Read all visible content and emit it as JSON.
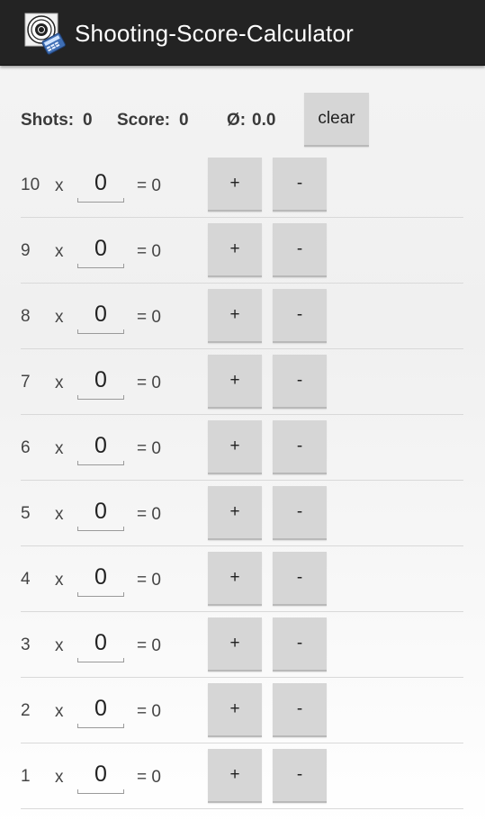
{
  "app": {
    "title": "Shooting-Score-Calculator",
    "icon": "target-calculator-icon"
  },
  "summary": {
    "shots_label": "Shots:",
    "shots_value": "0",
    "score_label": "Score:",
    "score_value": "0",
    "avg_label": "Ø:",
    "avg_value": "0.0",
    "clear_label": "clear"
  },
  "rows": [
    {
      "value": "10",
      "times": "x",
      "count": "0",
      "result": "= 0",
      "plus": "+",
      "minus": "-"
    },
    {
      "value": "9",
      "times": "x",
      "count": "0",
      "result": "= 0",
      "plus": "+",
      "minus": "-"
    },
    {
      "value": "8",
      "times": "x",
      "count": "0",
      "result": "= 0",
      "plus": "+",
      "minus": "-"
    },
    {
      "value": "7",
      "times": "x",
      "count": "0",
      "result": "= 0",
      "plus": "+",
      "minus": "-"
    },
    {
      "value": "6",
      "times": "x",
      "count": "0",
      "result": "= 0",
      "plus": "+",
      "minus": "-"
    },
    {
      "value": "5",
      "times": "x",
      "count": "0",
      "result": "= 0",
      "plus": "+",
      "minus": "-"
    },
    {
      "value": "4",
      "times": "x",
      "count": "0",
      "result": "= 0",
      "plus": "+",
      "minus": "-"
    },
    {
      "value": "3",
      "times": "x",
      "count": "0",
      "result": "= 0",
      "plus": "+",
      "minus": "-"
    },
    {
      "value": "2",
      "times": "x",
      "count": "0",
      "result": "= 0",
      "plus": "+",
      "minus": "-"
    },
    {
      "value": "1",
      "times": "x",
      "count": "0",
      "result": "= 0",
      "plus": "+",
      "minus": "-"
    }
  ],
  "colors": {
    "actionbar": "#232323",
    "button": "#d6d6d6",
    "divider": "#d9d9d9"
  }
}
